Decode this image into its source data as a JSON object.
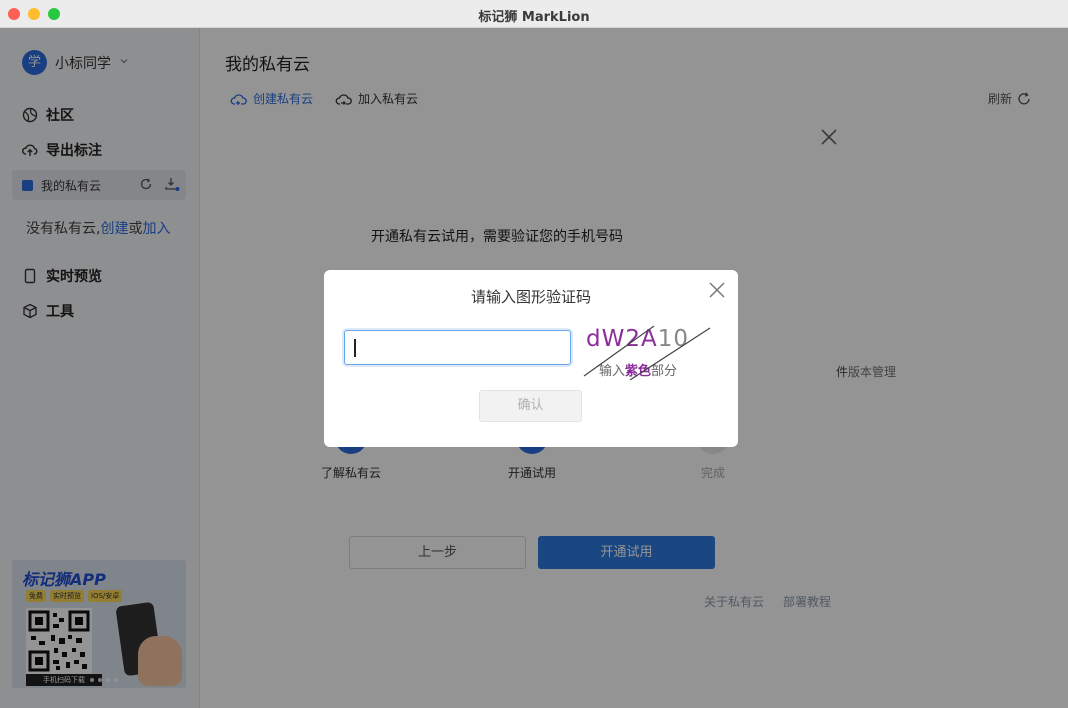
{
  "window": {
    "title": "标记狮 MarkLion"
  },
  "sidebar": {
    "user": {
      "avatar_char": "学",
      "name": "小标同学"
    },
    "nav": [
      {
        "label": "社区",
        "icon": "globe-icon"
      },
      {
        "label": "导出标注",
        "icon": "upload-cloud-icon"
      }
    ],
    "cloud_item": {
      "label": "我的私有云"
    },
    "no_cloud": {
      "prefix": "没有私有云,",
      "create": "创建",
      "or": "或",
      "join": "加入"
    },
    "nav2": [
      {
        "label": "实时预览",
        "icon": "phone-icon"
      },
      {
        "label": "工具",
        "icon": "cube-icon"
      }
    ],
    "promo": {
      "title": "标记狮APP",
      "tags": [
        "免费",
        "实时预览",
        "iOS/安卓"
      ],
      "qr_caption": "手机扫码下载"
    }
  },
  "main": {
    "title": "我的私有云",
    "create_label": "创建私有云",
    "join_label": "加入私有云",
    "refresh_label": "刷新"
  },
  "trial_dialog": {
    "heading": "开通私有云试用，需要验证您的手机号码",
    "partial_text": "件版本管理",
    "steps": [
      {
        "label": "了解私有云",
        "state": "done"
      },
      {
        "label": "开通试用",
        "state": "active"
      },
      {
        "label": "完成",
        "state": "pending"
      }
    ],
    "prev_label": "上一步",
    "open_label": "开通试用",
    "links": [
      "关于私有云",
      "部署教程"
    ]
  },
  "captcha_dialog": {
    "title": "请输入图形验证码",
    "input_value": "",
    "captcha_purple": "dW2A",
    "captcha_gray": "10",
    "hint_prefix": "输入",
    "hint_highlight": "紫色",
    "hint_suffix": "部分",
    "confirm_label": "确认"
  },
  "colors": {
    "accent": "#2e6ce0",
    "primary_button": "#2e7be0",
    "captcha_purple": "#8b2d9a"
  }
}
